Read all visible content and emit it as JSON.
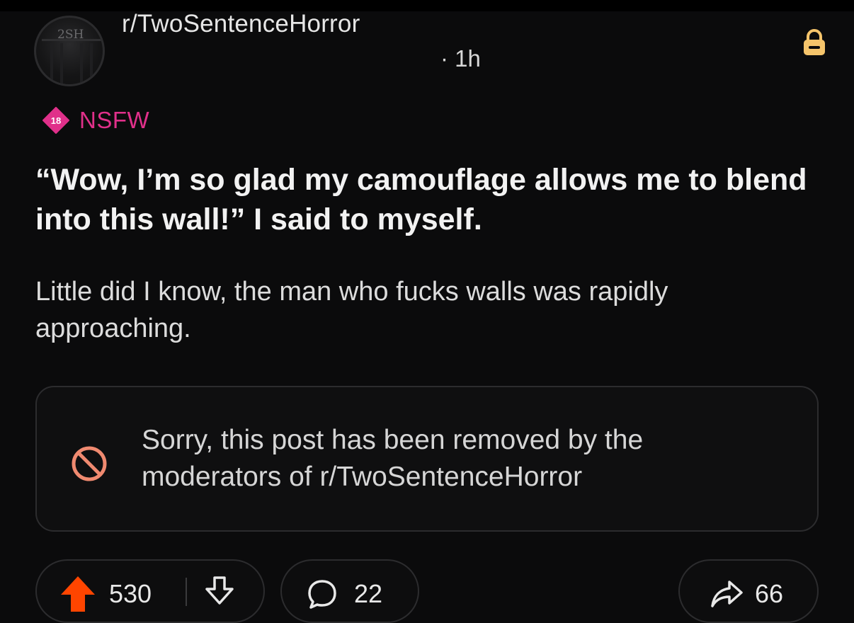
{
  "post": {
    "subreddit": "r/TwoSentenceHorror",
    "time": "· 1h",
    "avatar_text": "2SH",
    "nsfw_badge": "18",
    "nsfw_label": "NSFW",
    "title": "“Wow, I’m so glad my camouflage allows me to blend into this wall!” I said to myself.",
    "body": "Little did I know, the man who fucks walls was rapidly approaching.",
    "removed_notice": "Sorry, this post has been removed by the moderators of r/TwoSentenceHorror"
  },
  "actions": {
    "votes": "530",
    "comments": "22",
    "shares": "66"
  },
  "icons": {
    "lock": "lock-icon",
    "removed": "prohibited-icon",
    "upvote": "upvote-arrow-icon",
    "downvote": "downvote-arrow-icon",
    "comment": "comment-bubble-icon",
    "share": "share-arrow-icon"
  },
  "colors": {
    "background": "#0b0b0c",
    "nsfw": "#e0308a",
    "lock": "#f5c46b",
    "upvote": "#ff4500",
    "removed_icon": "#f08a70"
  }
}
